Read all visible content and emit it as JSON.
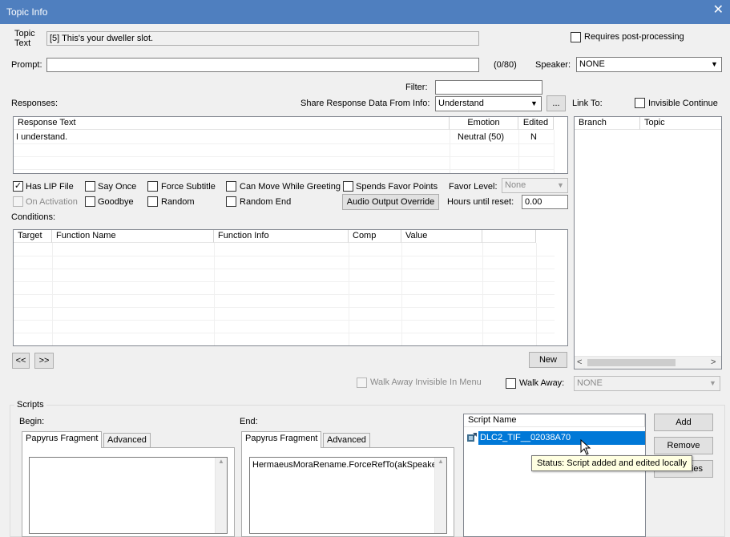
{
  "window": {
    "title": "Topic Info",
    "close_glyph": "✕"
  },
  "topic": {
    "label_line1": "Topic",
    "label_line2": "Text",
    "value": "[5] This's your dweller slot.",
    "requires_post_processing_label": "Requires post-processing"
  },
  "prompt": {
    "label": "Prompt:",
    "value": "",
    "counter": "(0/80)"
  },
  "speaker": {
    "label": "Speaker:",
    "value": "NONE"
  },
  "filter": {
    "label": "Filter:",
    "value": ""
  },
  "responses": {
    "label": "Responses:",
    "share_label": "Share Response Data From Info:",
    "share_value": "Understand",
    "ellipsis": "...",
    "columns": [
      "Response Text",
      "Emotion",
      "Edited"
    ],
    "rows": [
      {
        "text": "I understand.",
        "emotion": "Neutral (50)",
        "edited": "N"
      }
    ]
  },
  "link_to": {
    "label": "Link To:",
    "invisible_continue_label": "Invisible Continue",
    "columns": [
      "Branch",
      "Topic"
    ]
  },
  "options": {
    "has_lip_file": "Has LIP File",
    "has_lip_checkmark": "✓",
    "say_once": "Say Once",
    "force_subtitle": "Force Subtitle",
    "can_move_while_greeting": "Can Move While Greeting",
    "spends_favor_points": "Spends Favor Points",
    "favor_level_label": "Favor Level:",
    "favor_level_value": "None",
    "on_activation": "On Activation",
    "goodbye": "Goodbye",
    "random": "Random",
    "random_end": "Random End",
    "audio_output_override": "Audio Output Override",
    "hours_until_reset_label": "Hours until reset:",
    "hours_until_reset_value": "0.00"
  },
  "conditions": {
    "label": "Conditions:",
    "columns": [
      "Target",
      "Function Name",
      "Function Info",
      "Comp",
      "Value"
    ],
    "prev_button": "<<",
    "next_button": ">>",
    "new_button": "New"
  },
  "walk_away": {
    "invisible_in_menu_label": "Walk Away Invisible In Menu",
    "label": "Walk Away:",
    "value": "NONE"
  },
  "scripts": {
    "group_label": "Scripts",
    "begin_label": "Begin:",
    "end_label": "End:",
    "tab_papyrus": "Papyrus Fragment",
    "tab_advanced": "Advanced",
    "begin_code": "",
    "end_code": "HermaeusMoraRename.ForceRefTo(akSpeake",
    "list_header": "Script Name",
    "items": [
      {
        "name": "DLC2_TIF__02038A70"
      }
    ],
    "add_button": "Add",
    "remove_button": "Remove",
    "properties_button_visible": "ties"
  },
  "tooltip": {
    "text": "Status: Script added and edited locally"
  },
  "colors": {
    "titlebar": "#4f7fbf",
    "selection": "#0078d7",
    "tooltip_bg": "#ffffe1"
  }
}
